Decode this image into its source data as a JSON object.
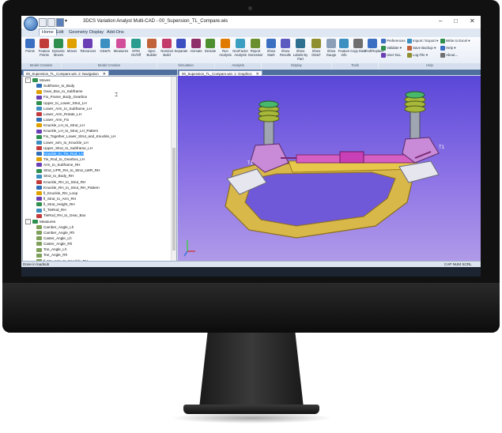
{
  "window": {
    "title": "3DCS Variation Analyst Multi-CAD - 00_Supension_TL_Compare.wis",
    "controls": {
      "minimize": "–",
      "maximize": "□",
      "close": "✕"
    }
  },
  "menu": [
    "Home",
    "Edit",
    "Geometry",
    "Display",
    "Add-Ons"
  ],
  "ribbon": {
    "buttons": [
      {
        "label": "Points",
        "color": "#3b6fc1"
      },
      {
        "label": "Feature Points",
        "color": "#c23b3b"
      },
      {
        "label": "Dynamic Moves",
        "color": "#2f8f4e"
      },
      {
        "label": "Moves",
        "color": "#e0a100"
      },
      {
        "label": "Tolerances",
        "color": "#6a3fb5"
      },
      {
        "label": "GD&Ts",
        "color": "#3b8fc1"
      },
      {
        "label": "Measures",
        "color": "#d14f9a"
      },
      {
        "label": "MTM On/Off",
        "color": "#2a9d8f"
      },
      {
        "label": "Spec Builder",
        "color": "#c1623b"
      },
      {
        "label": "Nominal Build",
        "color": "#c23b6a"
      },
      {
        "label": "Separate",
        "color": "#3b4fc1"
      },
      {
        "label": "Animate",
        "color": "#8f2f6a"
      },
      {
        "label": "Deviate",
        "color": "#4e8f2f"
      },
      {
        "label": "Run Analysis",
        "color": "#e07a00"
      },
      {
        "label": "GeoFactor Analysis",
        "color": "#3b9fc1"
      },
      {
        "label": "Report Generator",
        "color": "#6a8f2f"
      },
      {
        "label": "Show Mark",
        "color": "#3b6fc1"
      },
      {
        "label": "Show Results",
        "color": "#5a5ac1"
      },
      {
        "label": "Show Labels By Part",
        "color": "#2f6f8f"
      },
      {
        "label": "Show GD&T",
        "color": "#8f8f2f"
      },
      {
        "label": "Show Gauge",
        "color": "#8aa0b8"
      },
      {
        "label": "Feature Info",
        "color": "#3b8fc1"
      },
      {
        "label": "Copy Data",
        "color": "#6f6f6f"
      },
      {
        "label": "Find/Replace",
        "color": "#3b6fc1"
      }
    ],
    "groups": [
      "Model Creation",
      "Model Creation",
      "Simulation",
      "Analysis",
      "Display",
      "Tools",
      "Help"
    ],
    "side_buttons": [
      {
        "label": "Preferences",
        "color": "#3b6fc1"
      },
      {
        "label": "Validate ▾",
        "color": "#2f8f4e"
      },
      {
        "label": "User DLL",
        "color": "#6a3fb5"
      },
      {
        "label": "Import / Export ▾",
        "color": "#3b8fc1"
      },
      {
        "label": "Save Backup ▾",
        "color": "#c1623b"
      },
      {
        "label": "Log File ▾",
        "color": "#8f8f2f"
      },
      {
        "label": "Write to Excel ▾",
        "color": "#2f8f4e"
      },
      {
        "label": "Help ▾",
        "color": "#3b6fc1"
      },
      {
        "label": "About...",
        "color": "#6f6f6f"
      }
    ]
  },
  "tabs": {
    "navigation": "00_Supension_TL_Compare.wis: 2: Navigation",
    "graphics": "00_Supension_TL_Compare.wis: 1: Graphics",
    "close_glyph": "✕"
  },
  "tree": {
    "moves_header": "Moves",
    "moves": [
      "Subframe_to_Body",
      "Gear_Box_to_Subframe",
      "Fix_Frame_Body_Gearbox",
      "Upper_to_Lower_Strut_LH",
      "Lower_Arm_to_Subframe_LH",
      "Lower_Arm_Rotate_LH",
      "Lower_Arm_Fix",
      "Knuckle_LH_to_Strut_LH",
      "Knuckle_LH_to_Strut_LH_Pattern",
      "Fix_Together_Lower_Strut_and_Knuckle_LH",
      "Lower_arm_to_Knuckle_LH",
      "Upper_Strut_to_Subframe_LH",
      "Knuckle_to_Tie_Rod_LH",
      "Tie_Rod_to_Gearbox_LH",
      "Arm_to_Subframe_RH",
      "Strut_UPR_RH_to_Strut_LWR_RH",
      "Strut_to_Body_RH",
      "Knuckle_RH_to_Strut_RH",
      "Knuckle_RH_to_Strut_RH_Pattern",
      "fi_Knuckle_RH_Loop",
      "fi_Strut_to_Arm_RH",
      "fi_Strut_Height_RH",
      "fi_TieRod_RH",
      "TieRod_RH_to_Gear_Box"
    ],
    "selected_index": 12,
    "measures_header": "Measures",
    "measures": [
      "Camber_Angle_Lh",
      "Camber_Angle_Rh",
      "Caster_Angle_Lh",
      "Caster_Angle_Rh",
      "Toe_Angle_Lh",
      "Toe_Angle_Rh",
      "fi_Mv_Arm_to_Knuckle_RH"
    ]
  },
  "status": {
    "left": "Done in loadsub",
    "right": "CAP NUM SCRL"
  },
  "graphics_labels": [
    "T1",
    "T1"
  ],
  "colors": {
    "bg_top": "#5a47d8",
    "bg_bottom": "#b09ae8",
    "subframe": "#e8c84a",
    "links": "#c98ad8",
    "spring": "#a7b83a",
    "selection": "#3399ff"
  }
}
